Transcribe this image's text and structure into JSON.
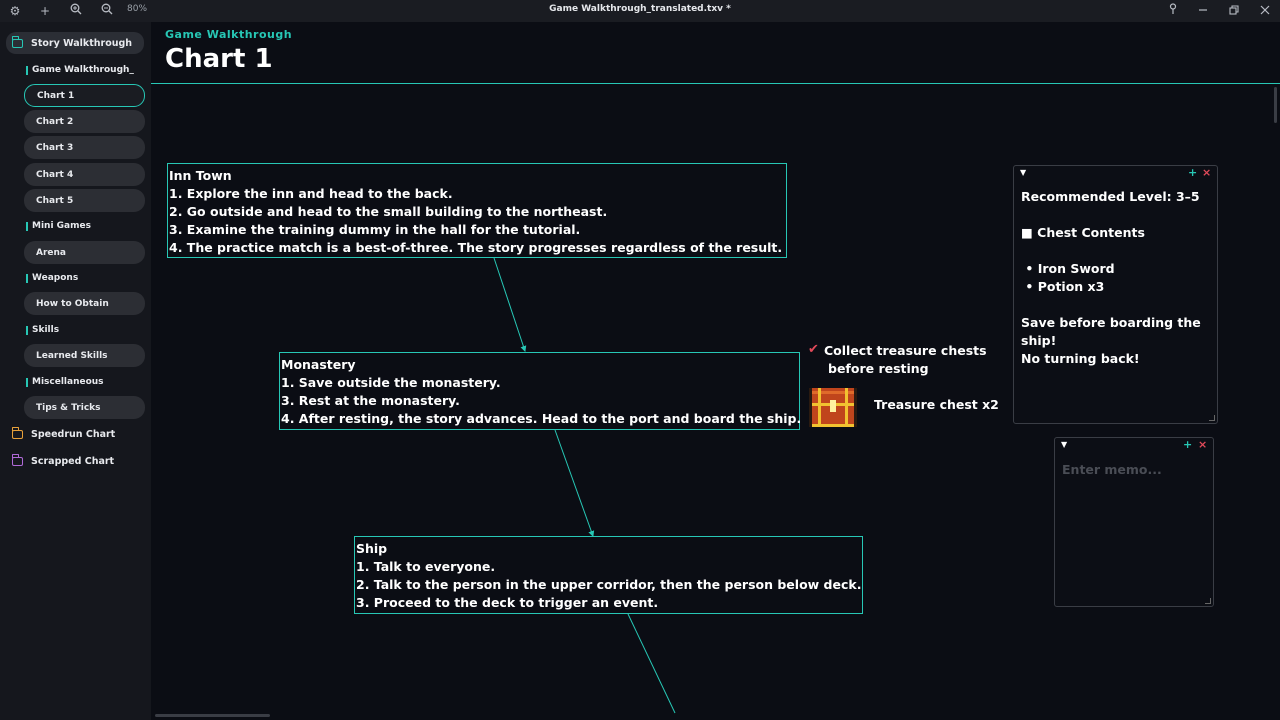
{
  "titlebar": {
    "zoom": "80%",
    "document_title": "Game Walkthrough_translated.txv *",
    "icons": [
      "gear-icon",
      "plus-icon",
      "zoom-in-icon",
      "zoom-out-icon",
      "pin-icon",
      "minimize-icon",
      "restore-icon",
      "close-icon"
    ]
  },
  "sidebar": {
    "folders": [
      {
        "label": "Story Walkthrough",
        "color": "#27c7b5"
      },
      {
        "label": "Speedrun Chart",
        "color": "#e8a13a"
      },
      {
        "label": "Scrapped Chart",
        "color": "#b06ad8"
      }
    ],
    "sections": [
      {
        "label": "Game Walkthrough_"
      },
      {
        "label": "Mini Games"
      },
      {
        "label": "Weapons"
      },
      {
        "label": "Skills"
      },
      {
        "label": "Miscellaneous"
      }
    ],
    "items": [
      {
        "label": "Chart 1"
      },
      {
        "label": "Chart 2"
      },
      {
        "label": "Chart 3"
      },
      {
        "label": "Chart 4"
      },
      {
        "label": "Chart 5"
      },
      {
        "label": "Arena"
      },
      {
        "label": "How to Obtain"
      },
      {
        "label": "Learned Skills"
      },
      {
        "label": "Tips & Tricks"
      }
    ]
  },
  "header": {
    "subtitle": "Game Walkthrough",
    "title": "Chart 1"
  },
  "nodes": {
    "inn": {
      "title": "Inn Town",
      "lines": [
        "1. Explore the inn and head to the back.",
        "2. Go outside and head to the small building to the northeast.",
        "3. Examine the training dummy in the hall for the tutorial.",
        "4. The practice match is a best-of-three. The story progresses regardless of the result."
      ]
    },
    "monastery": {
      "title": "Monastery",
      "lines": [
        "1. Save outside the monastery.",
        "3. Rest at the monastery.",
        "4. After resting, the story advances. Head to the port and board the ship."
      ]
    },
    "ship": {
      "title": "Ship",
      "lines": [
        "1. Talk to everyone.",
        "2. Talk to the person in the upper corridor, then the person below deck.",
        "3. Proceed to the deck to trigger an event."
      ]
    }
  },
  "annotations": {
    "check_mark": "✔",
    "collect_line1": "Collect treasure chests",
    "collect_line2": "before resting",
    "treasure_label": "Treasure chest x2"
  },
  "memos": {
    "memo1": {
      "text": "Recommended Level: 3–5\n\n■ Chest Contents\n\n • Iron Sword\n • Potion x3\n\nSave before boarding the ship!\nNo turning back!"
    },
    "memo2": {
      "placeholder": "Enter memo..."
    },
    "controls": {
      "collapse": "▼",
      "add": "+",
      "close": "×"
    }
  },
  "colors": {
    "accent": "#27c7b5",
    "close": "#e24a5a"
  }
}
